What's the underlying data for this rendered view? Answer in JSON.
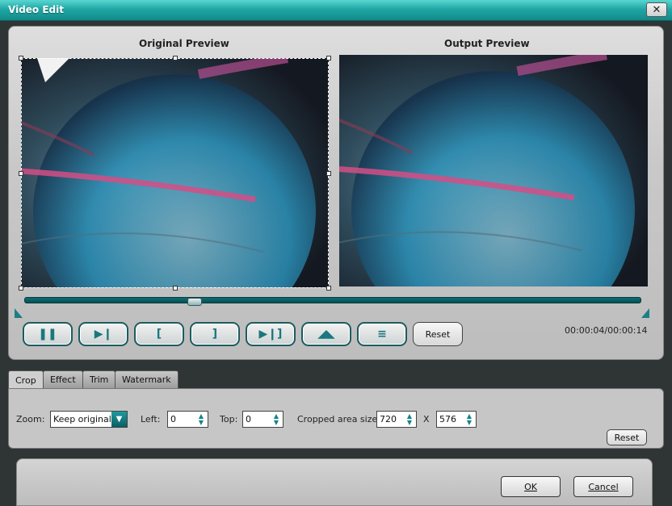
{
  "window": {
    "title": "Video Edit",
    "close_label": "✕"
  },
  "preview": {
    "original_label": "Original Preview",
    "output_label": "Output Preview",
    "time": "00:00:04/00:00:14",
    "reset_label": "Reset"
  },
  "controls": {
    "play_pause": "❚❚",
    "next_frame": "▶❙",
    "mark_in": "[",
    "mark_out": "]",
    "go_to_end": "▶❙]",
    "flip": "◢◣",
    "effect": "≡"
  },
  "tabs": [
    "Crop",
    "Effect",
    "Trim",
    "Watermark"
  ],
  "crop": {
    "zoom_label": "Zoom:",
    "zoom_value": "Keep original",
    "left_label": "Left:",
    "left_value": "0",
    "top_label": "Top:",
    "top_value": "0",
    "area_label": "Cropped area size:",
    "width_value": "720",
    "x_label": "X",
    "height_value": "576",
    "reset_label": "Reset"
  },
  "footer": {
    "ok_label": "OK",
    "cancel_label": "Cancel"
  },
  "colors": {
    "accent": "#1fa7a4",
    "frame": "#2f3435",
    "panel": "#c6c6c6"
  }
}
